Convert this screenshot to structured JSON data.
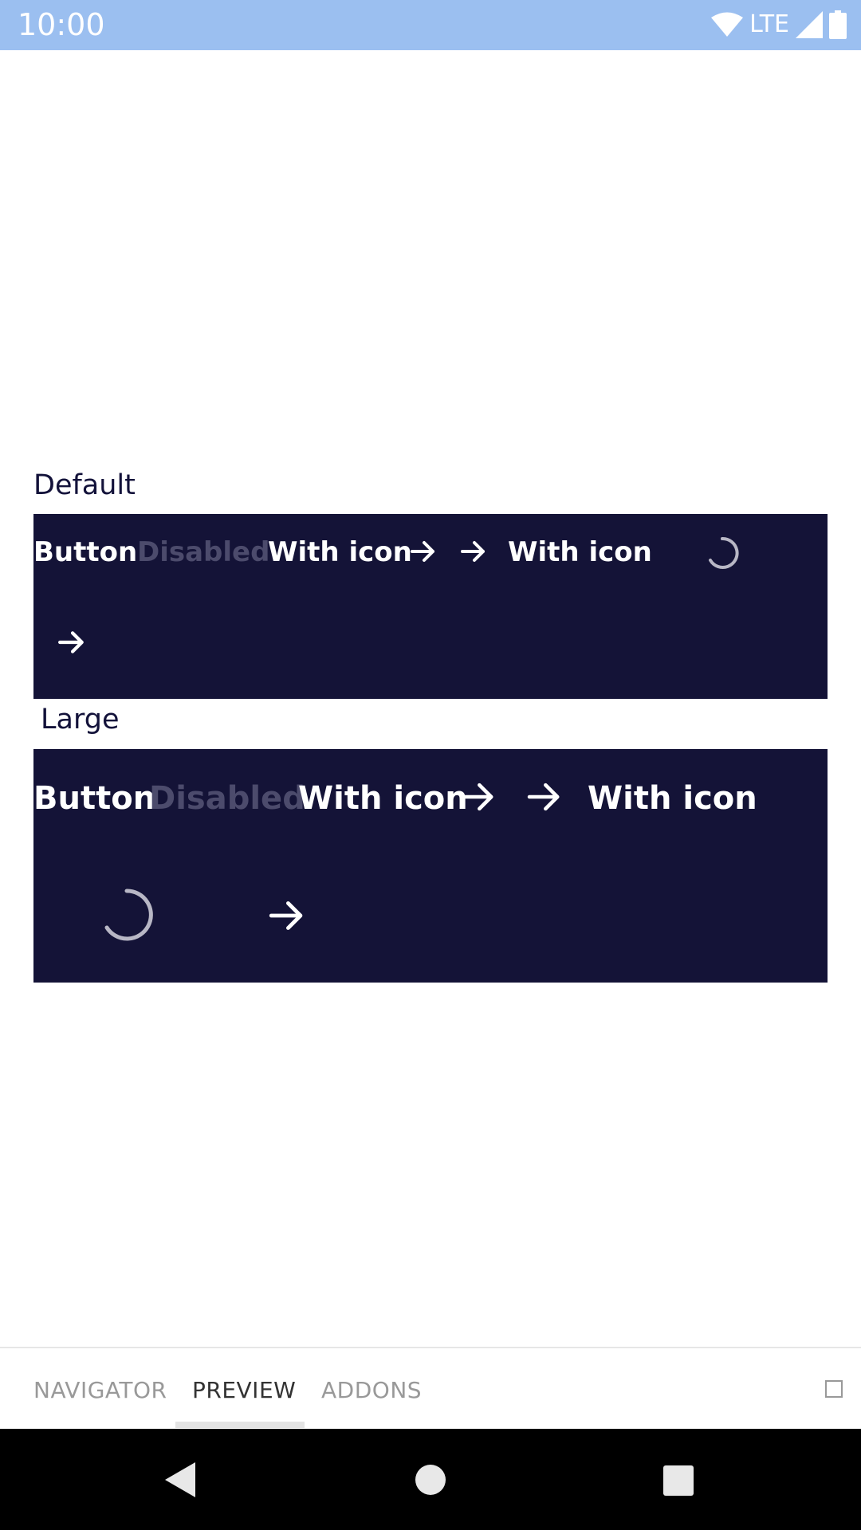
{
  "status_bar": {
    "time": "10:00",
    "network": "LTE",
    "icons": [
      "wifi-icon",
      "signal-icon",
      "battery-icon"
    ],
    "background": "#9bbff0"
  },
  "sections": [
    {
      "label": "Default",
      "buttons": [
        {
          "label": "Button",
          "state": "enabled"
        },
        {
          "label": "Disabled",
          "state": "disabled"
        },
        {
          "label": "With icon",
          "icon": "arrow-right-icon",
          "icon_position": "after"
        },
        {
          "label": "With icon",
          "icon": "arrow-right-icon",
          "icon_position": "before"
        },
        {
          "label": "",
          "state": "loading",
          "icon": "spinner-icon"
        },
        {
          "label": "",
          "icon": "arrow-right-icon",
          "icon_only": true
        }
      ]
    },
    {
      "label": "Large",
      "buttons": [
        {
          "label": "Button",
          "state": "enabled"
        },
        {
          "label": "Disabled",
          "state": "disabled"
        },
        {
          "label": "With icon",
          "icon": "arrow-right-icon",
          "icon_position": "after"
        },
        {
          "label": "With icon",
          "icon": "arrow-right-icon",
          "icon_position": "before"
        },
        {
          "label": "",
          "state": "loading",
          "icon": "spinner-icon"
        },
        {
          "label": "",
          "icon": "arrow-right-icon",
          "icon_only": true
        }
      ]
    }
  ],
  "panel_color": "#141337",
  "disabled_color": "#4c4b6c",
  "tabbar": {
    "tabs": [
      {
        "label": "NAVIGATOR",
        "active": false
      },
      {
        "label": "PREVIEW",
        "active": true
      },
      {
        "label": "ADDONS",
        "active": false
      }
    ],
    "menu_icon": "square-icon"
  },
  "navbar": {
    "icons": [
      "back-icon",
      "home-icon",
      "recents-icon"
    ]
  }
}
